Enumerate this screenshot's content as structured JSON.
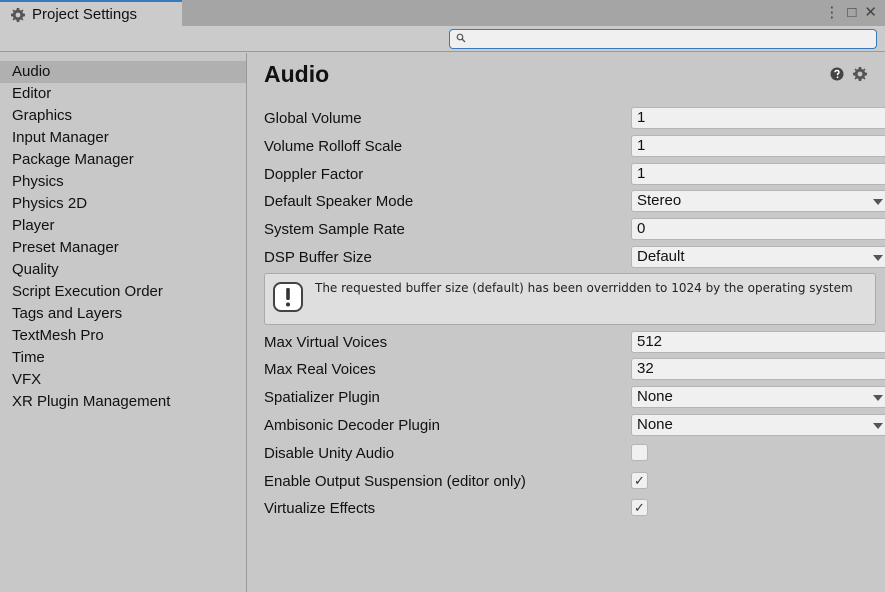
{
  "window": {
    "tab_title": "Project Settings",
    "menu_glyph": "⋮",
    "maximize_glyph": "□",
    "close_glyph": "✕"
  },
  "search": {
    "placeholder": "",
    "value": ""
  },
  "sidebar": {
    "items": [
      {
        "label": "Audio",
        "selected": true
      },
      {
        "label": "Editor"
      },
      {
        "label": "Graphics"
      },
      {
        "label": "Input Manager"
      },
      {
        "label": "Package Manager"
      },
      {
        "label": "Physics"
      },
      {
        "label": "Physics 2D"
      },
      {
        "label": "Player"
      },
      {
        "label": "Preset Manager"
      },
      {
        "label": "Quality"
      },
      {
        "label": "Script Execution Order"
      },
      {
        "label": "Tags and Layers"
      },
      {
        "label": "TextMesh Pro"
      },
      {
        "label": "Time"
      },
      {
        "label": "VFX"
      },
      {
        "label": "XR Plugin Management"
      }
    ]
  },
  "main": {
    "title": "Audio",
    "settings": {
      "global_volume": {
        "label": "Global Volume",
        "value": "1"
      },
      "volume_rolloff_scale": {
        "label": "Volume Rolloff Scale",
        "value": "1"
      },
      "doppler_factor": {
        "label": "Doppler Factor",
        "value": "1"
      },
      "default_speaker_mode": {
        "label": "Default Speaker Mode",
        "value": "Stereo"
      },
      "system_sample_rate": {
        "label": "System Sample Rate",
        "value": "0"
      },
      "dsp_buffer_size": {
        "label": "DSP Buffer Size",
        "value": "Default"
      },
      "help_message": "The requested buffer size (default) has been overridden to 1024 by the operating system",
      "max_virtual_voices": {
        "label": "Max Virtual Voices",
        "value": "512"
      },
      "max_real_voices": {
        "label": "Max Real Voices",
        "value": "32"
      },
      "spatializer_plugin": {
        "label": "Spatializer Plugin",
        "value": "None"
      },
      "ambisonic_decoder_plugin": {
        "label": "Ambisonic Decoder Plugin",
        "value": "None"
      },
      "disable_unity_audio": {
        "label": "Disable Unity Audio",
        "checked": false
      },
      "enable_output_suspension": {
        "label": "Enable Output Suspension (editor only)",
        "checked": true
      },
      "virtualize_effects": {
        "label": "Virtualize Effects",
        "checked": true
      }
    }
  },
  "icons": {
    "tab": "gear-icon",
    "search": "search-icon",
    "help": "help-icon",
    "settings": "settings-icon",
    "warning": "warning-icon"
  },
  "colors": {
    "accent": "#3a79bb",
    "panel": "#c8c8c8",
    "field": "#f0f0f0",
    "selected": "#b0b0b0"
  },
  "check_glyph": "✓"
}
